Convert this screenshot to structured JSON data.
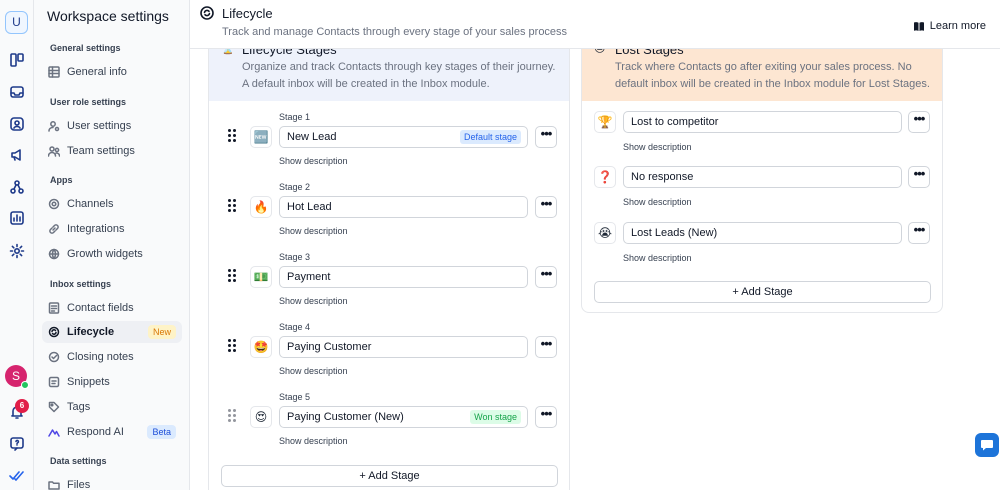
{
  "rail": {
    "workspace_initial": "U",
    "avatar_initial": "S",
    "notification_count": "6",
    "icons": [
      "kanban-icon",
      "inbox-icon",
      "contacts-icon",
      "broadcast-icon",
      "workflows-icon",
      "reports-icon",
      "settings-icon",
      "notifications-icon",
      "help-icon",
      "checkmarks-icon"
    ]
  },
  "sidebar": {
    "title": "Workspace settings",
    "sections": {
      "general": "General settings",
      "user_role": "User role settings",
      "apps": "Apps",
      "inbox": "Inbox settings",
      "data": "Data settings"
    },
    "items": {
      "general_info": "General info",
      "user_settings": "User settings",
      "team_settings": "Team settings",
      "channels": "Channels",
      "integrations": "Integrations",
      "growth_widgets": "Growth widgets",
      "contact_fields": "Contact fields",
      "lifecycle": "Lifecycle",
      "lifecycle_tag": "New",
      "closing_notes": "Closing notes",
      "snippets": "Snippets",
      "tags": "Tags",
      "respond_ai": "Respond AI",
      "respond_ai_tag": "Beta",
      "files": "Files"
    }
  },
  "header": {
    "title": "Lifecycle",
    "subtitle": "Track and manage Contacts through every stage of your sales process",
    "learn_more": "Learn more"
  },
  "lifecycle_stages": {
    "emoji": "⏳",
    "title": "Lifecycle Stages",
    "desc_line1": "Organize and track Contacts through key stages of their journey.",
    "desc_line2": "A default inbox will be created in the Inbox module.",
    "stages": [
      {
        "label": "Stage 1",
        "emoji": "🆕",
        "name": "New Lead",
        "pill": "Default stage",
        "show": "Show description"
      },
      {
        "label": "Stage 2",
        "emoji": "🔥",
        "name": "Hot Lead",
        "pill": "",
        "show": "Show description"
      },
      {
        "label": "Stage 3",
        "emoji": "💵",
        "name": "Payment",
        "pill": "",
        "show": "Show description"
      },
      {
        "label": "Stage 4",
        "emoji": "🤩",
        "name": "Paying Customer",
        "pill": "",
        "show": "Show description"
      },
      {
        "label": "Stage 5",
        "emoji": "😍",
        "name": "Paying Customer (New)",
        "pill": "Won stage",
        "show": "Show description"
      }
    ],
    "add_stage": "+ Add Stage"
  },
  "lost_stages": {
    "emoji": "😔",
    "title": "Lost Stages",
    "desc_line1": "Track where Contacts go after exiting your sales process. No",
    "desc_line2": "default inbox will be created in the Inbox module for Lost Stages.",
    "stages": [
      {
        "emoji": "🏆",
        "name": "Lost to competitor",
        "show": "Show description"
      },
      {
        "emoji": "❓",
        "name": "No response",
        "show": "Show description"
      },
      {
        "emoji": "😭",
        "name": "Lost Leads (New)",
        "show": "Show description"
      }
    ],
    "add_stage": "+ Add Stage"
  },
  "more_glyph": "•••"
}
